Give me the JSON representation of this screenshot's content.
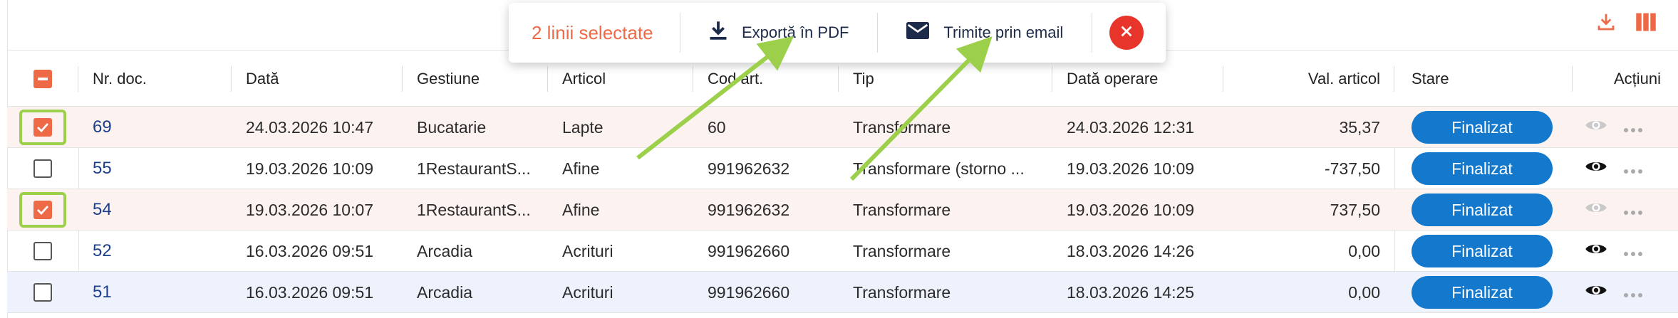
{
  "toolbar": {
    "selected_label": "2 linii selectate",
    "export_pdf_label": "Exportă în PDF",
    "email_label": "Trimite prin email"
  },
  "columns": {
    "nr_doc": "Nr. doc.",
    "data": "Dată",
    "gestiune": "Gestiune",
    "articol": "Articol",
    "cod_art": "Cod art.",
    "tip": "Tip",
    "data_operare": "Dată operare",
    "val_articol": "Val. articol",
    "stare": "Stare",
    "actiuni": "Acțiuni"
  },
  "rows": [
    {
      "nr": "69",
      "data": "24.03.2026 10:47",
      "gestiune": "Bucatarie",
      "articol": "Lapte",
      "cod": "60",
      "tip": "Transformare",
      "data_operare": "24.03.2026 12:31",
      "val": "35,37",
      "stare": "Finalizat",
      "checked": true
    },
    {
      "nr": "55",
      "data": "19.03.2026 10:09",
      "gestiune": "1RestaurantS...",
      "articol": "Afine",
      "cod": "991962632",
      "tip": "Transformare (storno ...",
      "data_operare": "19.03.2026 10:09",
      "val": "-737,50",
      "stare": "Finalizat",
      "checked": false
    },
    {
      "nr": "54",
      "data": "19.03.2026 10:07",
      "gestiune": "1RestaurantS...",
      "articol": "Afine",
      "cod": "991962632",
      "tip": "Transformare",
      "data_operare": "19.03.2026 10:09",
      "val": "737,50",
      "stare": "Finalizat",
      "checked": true
    },
    {
      "nr": "52",
      "data": "16.03.2026 09:51",
      "gestiune": "Arcadia",
      "articol": "Acrituri",
      "cod": "991962660",
      "tip": "Transformare",
      "data_operare": "18.03.2026 14:26",
      "val": "0,00",
      "stare": "Finalizat",
      "checked": false
    },
    {
      "nr": "51",
      "data": "16.03.2026 09:51",
      "gestiune": "Arcadia",
      "articol": "Acrituri",
      "cod": "991962660",
      "tip": "Transformare",
      "data_operare": "18.03.2026 14:25",
      "val": "0,00",
      "stare": "Finalizat",
      "checked": false
    }
  ],
  "colors": {
    "accent": "#ee6a47",
    "status_button": "#1479cc",
    "close_button": "#e8352b",
    "annotation": "#9ccf4a"
  },
  "icons": [
    "download-icon",
    "columns-icon",
    "email-icon",
    "close-icon",
    "eye-icon",
    "more-icon",
    "checkbox-icon"
  ]
}
